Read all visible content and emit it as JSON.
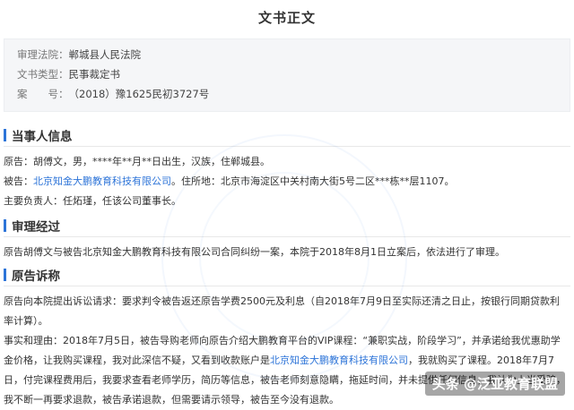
{
  "header": {
    "title": "文书正文"
  },
  "meta": [
    {
      "label": "审理法院：",
      "value": "郸城县人民法院"
    },
    {
      "label": "文书类型：",
      "value": "民事裁定书"
    },
    {
      "label": "案　　号：",
      "value": "（2018）豫1625民初3727号"
    }
  ],
  "parties": {
    "title": "当事人信息",
    "plaintiff": "原告：胡傅文，男，****年**月**日出生，汉族，住郸城县。",
    "defendant_prefix": "被告：",
    "defendant_name": "北京知金大鹏教育科技有限公司",
    "defendant_suffix": "。住所地：北京市海淀区中关村南大街5号二区***栋**层1107。",
    "representative": "主要负责人：任炻瑾，任该公司董事长。"
  },
  "trial": {
    "title": "审理经过",
    "text": "原告胡傅文与被告北京知金大鹏教育科技有限公司合同纠纷一案，本院于2018年8月1日立案后，依法进行了审理。"
  },
  "complaint": {
    "title": "原告诉称",
    "line1": "原告向本院提出诉讼请求：要求判令被告返还原告学费2500元及利息（自2018年7月9日至实际还清之日止，按银行同期贷款利率计算）。",
    "line2_prefix": "事实和理由：2018年7月5日，被告导购老师向原告介绍大鹏教育平台的VIP课程：“兼职实战，阶段学习”，并承诺给我优惠助学金价格，让我购买课程，我对此深信不疑，又看到收款账户是",
    "line2_link": "北京知金大鹏教育科技有限公司",
    "line2_suffix": "，我就购买了课程。2018年7月7日，付完课程费用后，我要求查看老师学历，简历等信息，被告老师刻意隐瞒，拖延时间，并未提供任何信息，我认为上当受骗，我不断一再要求退款，被告承诺退款，但需要请示领导，被告至今没有退款。"
  },
  "watermark_stamp": {
    "text": "头条 @泛亚教育联盟"
  }
}
